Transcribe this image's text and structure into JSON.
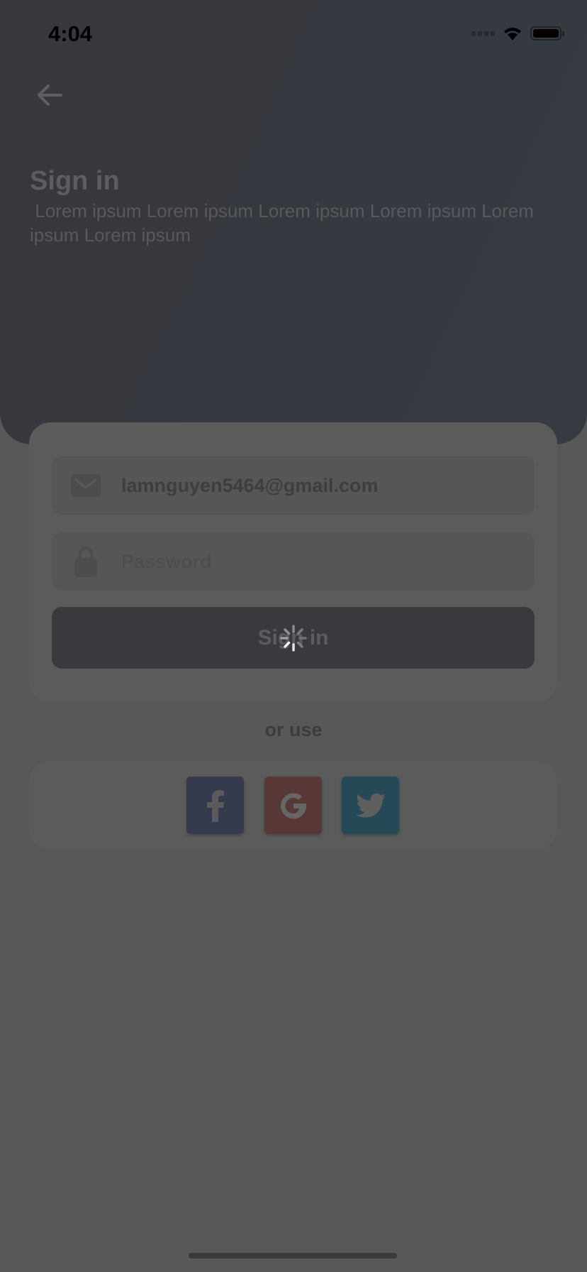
{
  "status_bar": {
    "time": "4:04"
  },
  "header": {
    "title": "Sign in",
    "subtitle": " Lorem ipsum Lorem ipsum Lorem ipsum Lorem ipsum Lorem ipsum Lorem ipsum"
  },
  "form": {
    "email_value": "lamnguyen5464@gmail.com",
    "password_placeholder": "Password",
    "submit_label": "Sign in"
  },
  "alt_login": {
    "label": "or use",
    "providers": [
      "facebook",
      "google",
      "twitter"
    ]
  },
  "colors": {
    "facebook": "#343b4c",
    "google": "#583836",
    "twitter": "#254956",
    "overlay": "#585858"
  }
}
